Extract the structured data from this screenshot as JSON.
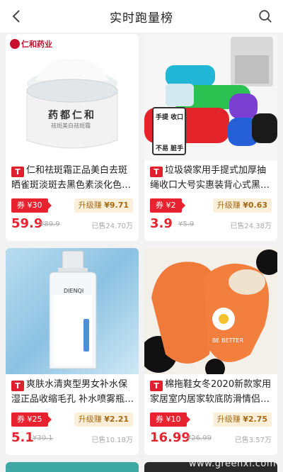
{
  "header": {
    "title": "实时跑量榜",
    "back_icon": "chevron-left-icon",
    "search_icon": "search-icon"
  },
  "products": [
    {
      "brand": "仁和药业",
      "jar_brand": "药都仁和",
      "jar_sub": "祛斑美白祛斑霜",
      "name": "仁和祛斑霜正品美白去斑晒雀斑淡斑去黑色素淡化色…",
      "coupon": "券 ¥30",
      "earn_label": "升级赚",
      "earn_value": "¥9.71",
      "price": "59.9",
      "orig": "¥89.9",
      "sold": "已售24.70万"
    },
    {
      "tag1": "手提 收口",
      "tag2": "不易 脏手",
      "name": "垃圾袋家用手提式加厚抽绳收口大号实惠装背心式黑…",
      "coupon": "券 ¥2",
      "earn_label": "升级赚",
      "earn_value": "¥0.63",
      "price": "3.9",
      "orig": "¥5.9",
      "sold": "已售24.38万"
    },
    {
      "bottle_brand": "DIENQI",
      "name": "爽肤水清爽型男女补水保湿正品收缩毛孔 补水喷雾瓶…",
      "coupon": "券 ¥25",
      "earn_label": "升级赚",
      "earn_value": "¥2.21",
      "price": "5.1",
      "orig": "¥30.1",
      "sold": "已售10.18万"
    },
    {
      "slipper_text": "BE BETTER",
      "name": "棉拖鞋女冬2020新款家用家居室内居家软底防滑情侣…",
      "coupon": "券 ¥10",
      "earn_label": "升级赚",
      "earn_value": "¥2.75",
      "price": "16.99",
      "orig": "¥26.99",
      "sold": "已售3.57万"
    }
  ],
  "tmall_badge": "T",
  "watermark": "www.greenxf.com",
  "colors": {
    "accent": "#e8232f",
    "earn_bg": "#fcefd9",
    "earn_text": "#a36a16"
  }
}
